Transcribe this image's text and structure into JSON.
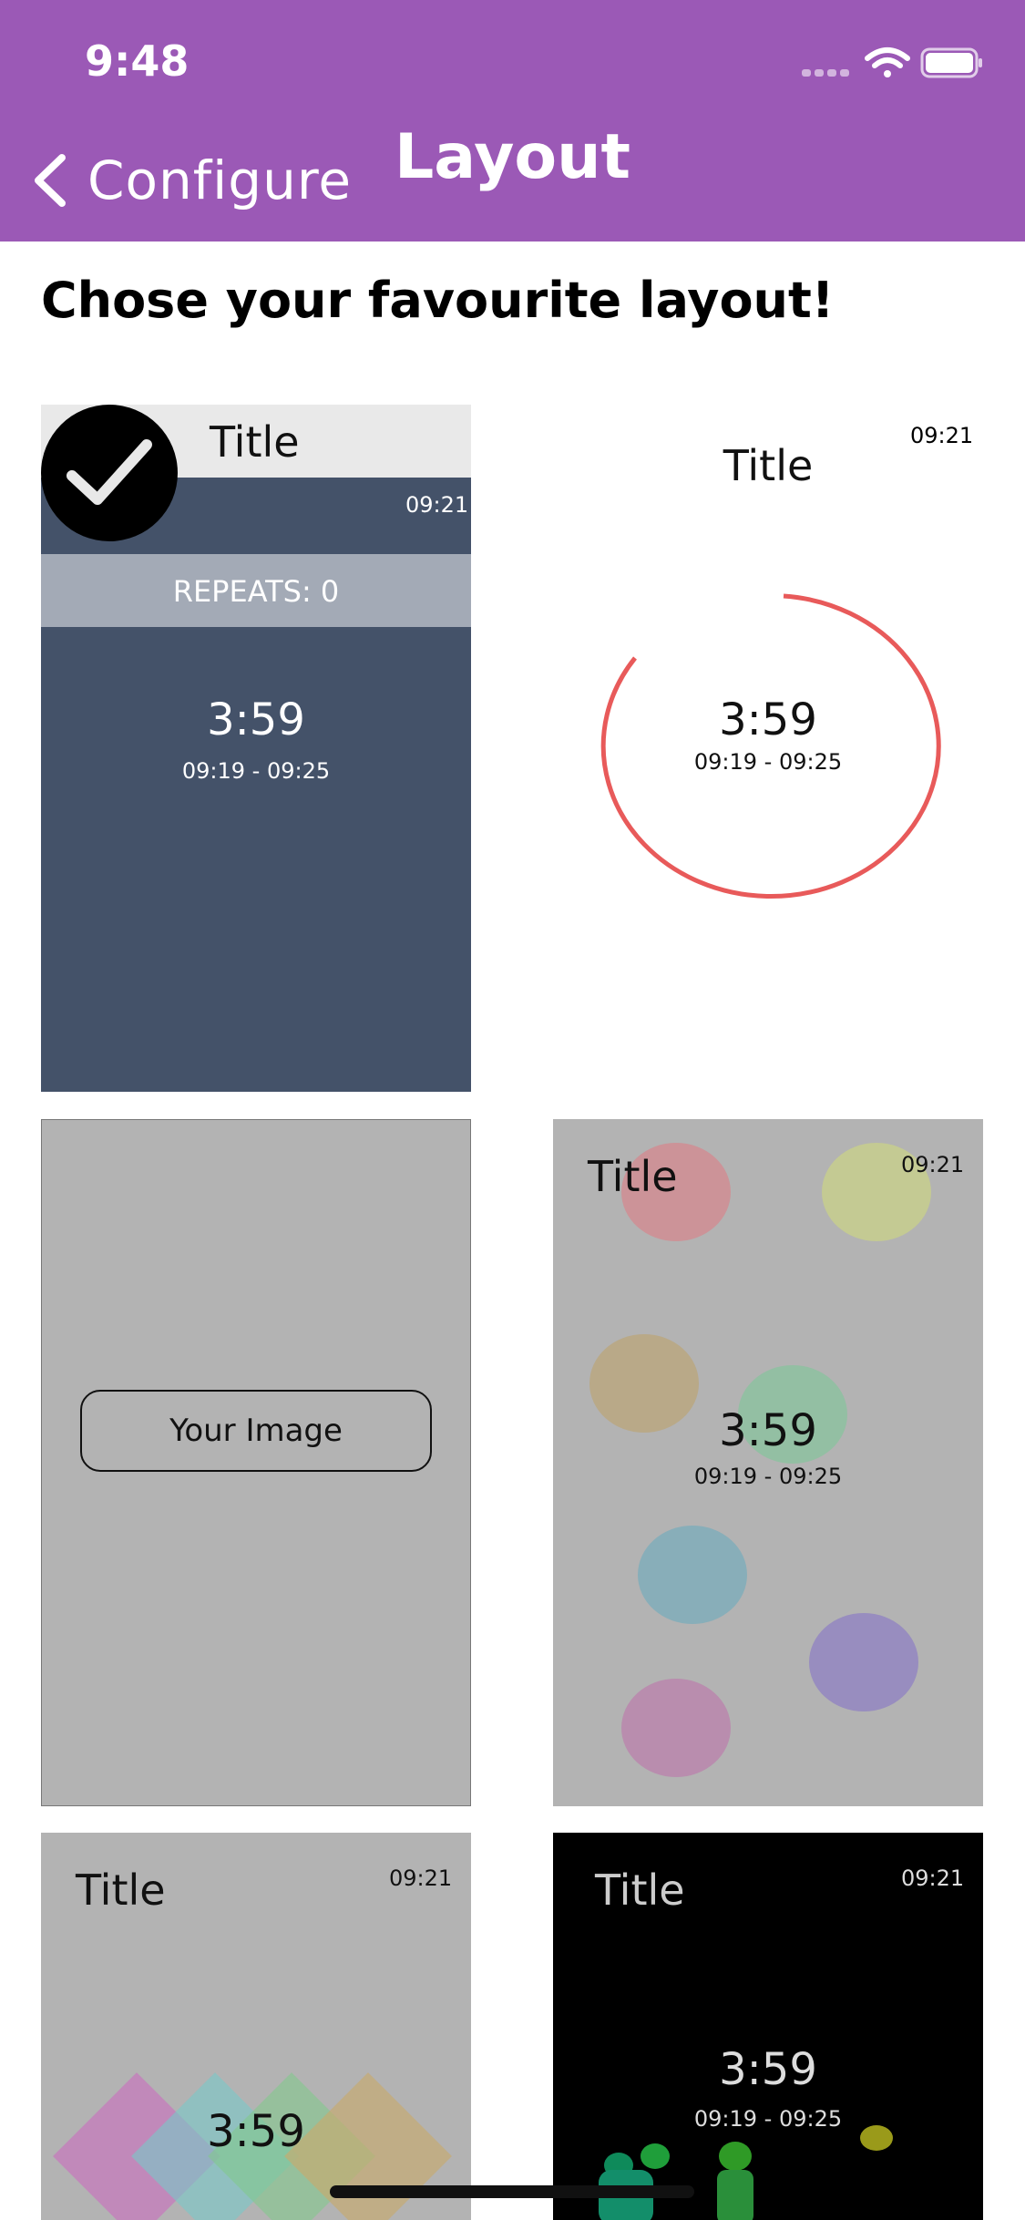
{
  "status_bar": {
    "time": "9:48"
  },
  "nav": {
    "back_label": "Configure",
    "title": "Layout"
  },
  "heading": "Chose your favourite layout!",
  "tiles": [
    {
      "title": "Title",
      "clock": "09:21",
      "repeats": "REPEATS: 0",
      "timer": "3:59",
      "range": "09:19 - 09:25",
      "selected": true
    },
    {
      "title": "Title",
      "clock": "09:21",
      "timer": "3:59",
      "range": "09:19 - 09:25",
      "ring_color": "#e85a5a"
    },
    {
      "button_label": "Your Image"
    },
    {
      "title": "Title",
      "clock": "09:21",
      "timer": "3:59",
      "range": "09:19 - 09:25"
    },
    {
      "title": "Title",
      "clock": "09:21",
      "timer": "3:59"
    },
    {
      "title": "Title",
      "clock": "09:21",
      "timer": "3:59",
      "range": "09:19 - 09:25"
    }
  ],
  "colors": {
    "header": "#9b59b6",
    "tile1_bg": "#445269",
    "ring": "#e85a5a"
  }
}
